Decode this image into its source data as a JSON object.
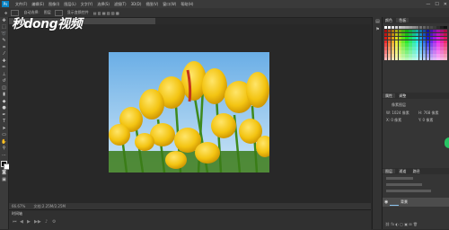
{
  "app": {
    "menu": [
      "文件(F)",
      "编辑(E)",
      "图像(I)",
      "图层(L)",
      "文字(Y)",
      "选择(S)",
      "滤镜(T)",
      "3D(D)",
      "视图(V)",
      "窗口(W)",
      "帮助(H)"
    ],
    "window_controls": [
      "—",
      "☐",
      "✕"
    ]
  },
  "options_bar": {
    "items": [
      "自动选择:",
      "图层",
      "显示变换控件"
    ]
  },
  "watermark": "秒dong视频",
  "document": {
    "tab_title": "",
    "status_text": "66.67%",
    "status_doc": "文档:2.25M/2.25M"
  },
  "timeline": {
    "tab_label": "时间轴"
  },
  "right_panels": {
    "top_tabs": [
      "颜色",
      "色板"
    ],
    "properties_tabs": [
      "属性",
      "调整"
    ],
    "properties_title": "像素图层",
    "prop_lines": [
      "W: 1024 像素",
      "H: 768 像素",
      "X: 0 像素",
      "Y: 0 像素"
    ],
    "layers_tabs": [
      "图层",
      "通道",
      "路径"
    ],
    "layer_name": "背景"
  },
  "colors": {
    "accent_blue": "#0a84c6",
    "green_dot": "#27c262"
  }
}
